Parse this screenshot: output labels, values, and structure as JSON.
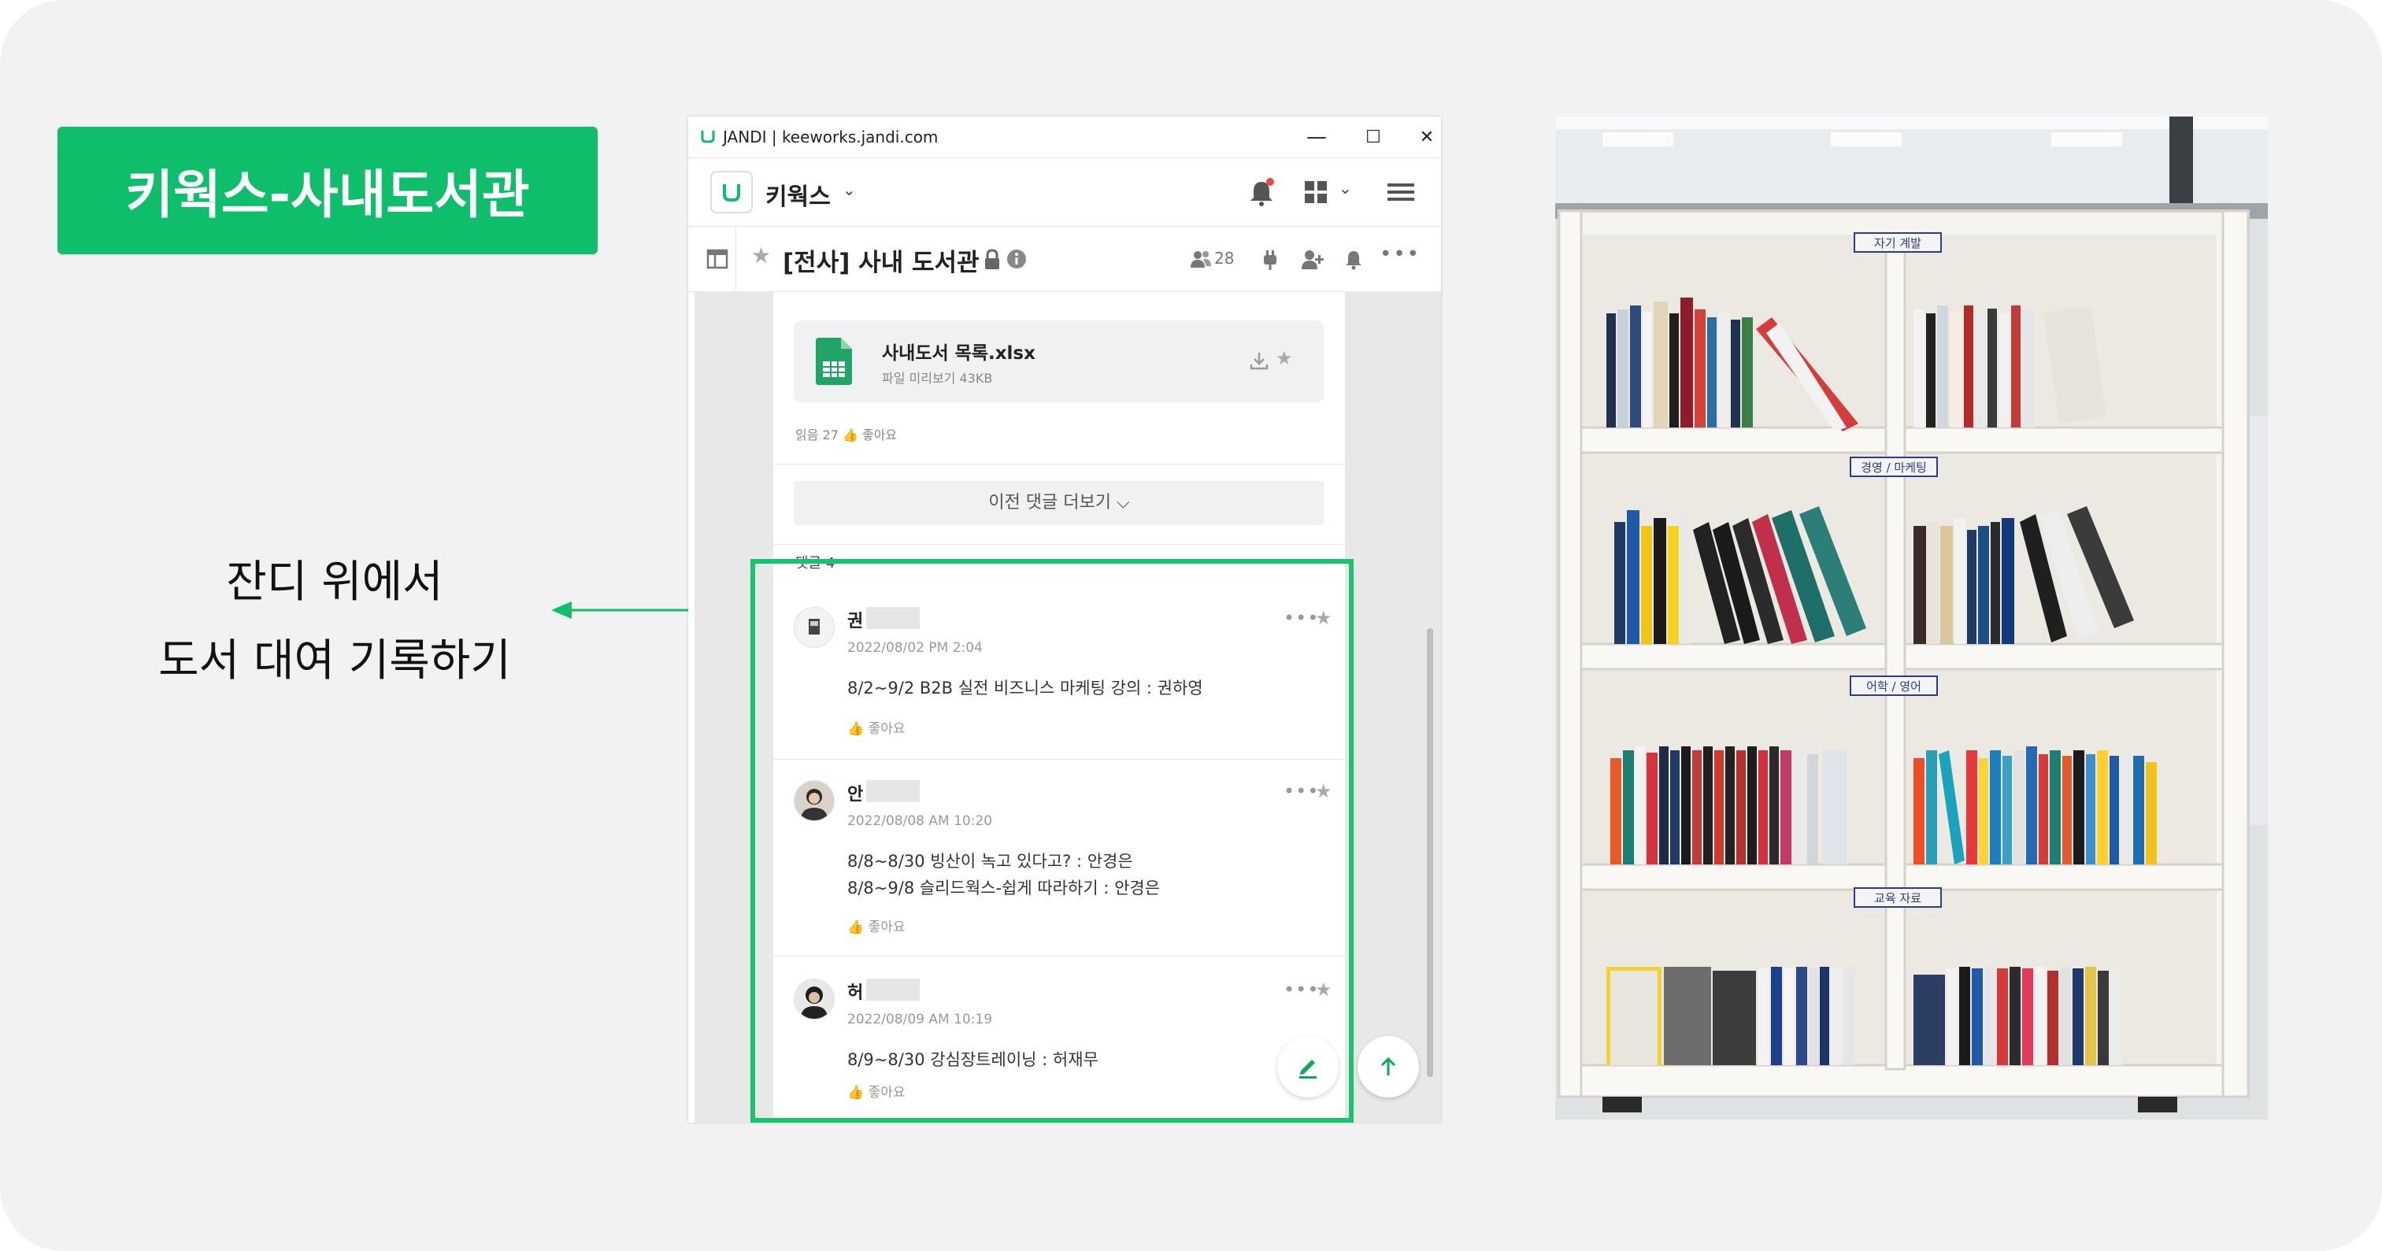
{
  "slide": {
    "title": "키웍스-사내도서관",
    "caption_lines": [
      "잔디 위에서",
      "도서 대여 기록하기"
    ]
  },
  "window": {
    "titlebar": "JANDI | keeworks.jandi.com",
    "controls": {
      "minimize": "—",
      "maximize": "☐",
      "close": "✕"
    },
    "team_name": "키웍스",
    "topic": {
      "name": "[전사] 사내 도서관",
      "member_count": "28"
    },
    "file": {
      "name": "사내도서 목록.xlsx",
      "sub": "파일 미리보기 43KB"
    },
    "post_meta": "읽음 27 👍 좋아요",
    "more_comments": "이전 댓글 더보기 ⌵",
    "comments_header": "댓글 4",
    "comments": [
      {
        "name": "권",
        "time": "2022/08/02 PM 2:04",
        "text": "8/2~9/2 B2B 실전 비즈니스 마케팅 강의 : 권하영",
        "like": "좋아요"
      },
      {
        "name": "안",
        "time": "2022/08/08 AM 10:20",
        "text": "8/8~8/30 빙산이 녹고 있다고? : 안경은\n8/8~9/8 슬리드웍스-쉽게 따라하기 : 안경은",
        "like": "좋아요"
      },
      {
        "name": "허",
        "time": "2022/08/09 AM 10:19",
        "text": "8/9~8/30 강심장트레이닝 : 허재무",
        "like": "좋아요"
      }
    ]
  },
  "photo": {
    "shelf_labels": [
      "자기 계발",
      "경영 / 마케팅",
      "어학 / 영어",
      "교육 자료"
    ]
  },
  "colors": {
    "brand_green": "#0fbe6b",
    "highlight": "#19c36d"
  }
}
